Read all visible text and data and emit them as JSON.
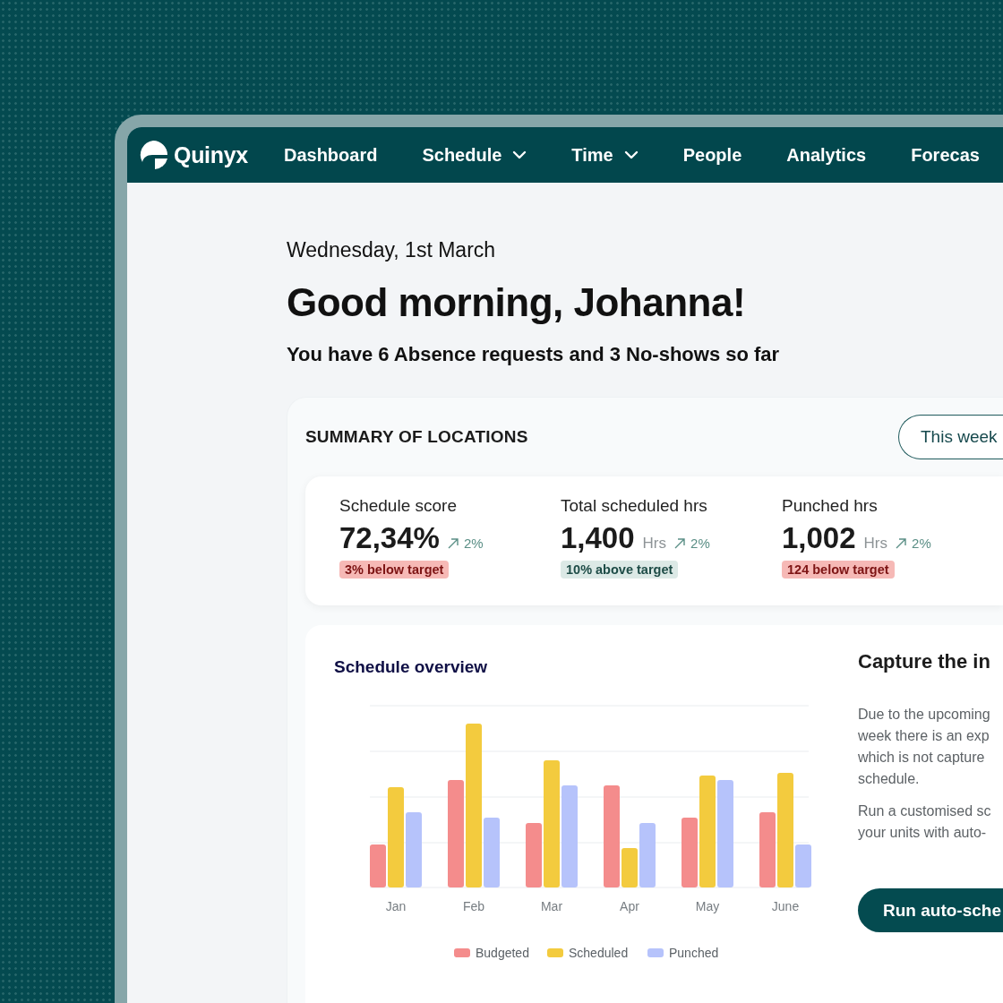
{
  "brand": {
    "name": "Quinyx"
  },
  "nav": [
    {
      "label": "Dashboard",
      "dropdown": false
    },
    {
      "label": "Schedule",
      "dropdown": true
    },
    {
      "label": "Time",
      "dropdown": true
    },
    {
      "label": "People",
      "dropdown": false
    },
    {
      "label": "Analytics",
      "dropdown": false
    },
    {
      "label": "Forecas",
      "dropdown": false
    }
  ],
  "greeting": {
    "date": "Wednesday, 1st March",
    "title": "Good morning, Johanna!",
    "subtitle": "You have 6 Absence requests and 3 No-shows so far"
  },
  "summary": {
    "title": "SUMMARY OF LOCATIONS",
    "period_button": "This week",
    "stats": [
      {
        "label": "Schedule score",
        "value": "72,34%",
        "trend": "2%",
        "badge": "3% below target",
        "kind": "below"
      },
      {
        "label": "Total scheduled hrs",
        "value": "1,400",
        "unit": "Hrs",
        "trend": "2%",
        "badge": "10% above target",
        "kind": "above"
      },
      {
        "label": "Punched hrs",
        "value": "1,002",
        "unit": "Hrs",
        "trend": "2%",
        "badge": "124 below target",
        "kind": "below"
      }
    ]
  },
  "overview": {
    "title": "Schedule overview",
    "categories": [
      "Jan",
      "Feb",
      "Mar",
      "Apr",
      "May",
      "June"
    ],
    "legend": [
      {
        "name": "Budgeted",
        "color": "#f48c8c"
      },
      {
        "name": "Scheduled",
        "color": "#f3cb3e"
      },
      {
        "name": "Punched",
        "color": "#b6c3fb"
      }
    ]
  },
  "insight": {
    "title": "Capture the in",
    "lines": [
      "Due to the upcoming",
      "week there is an exp",
      "which is not capture",
      "schedule.",
      "Run a customised sc",
      "your units with auto-"
    ],
    "button": "Run auto-sche"
  }
}
